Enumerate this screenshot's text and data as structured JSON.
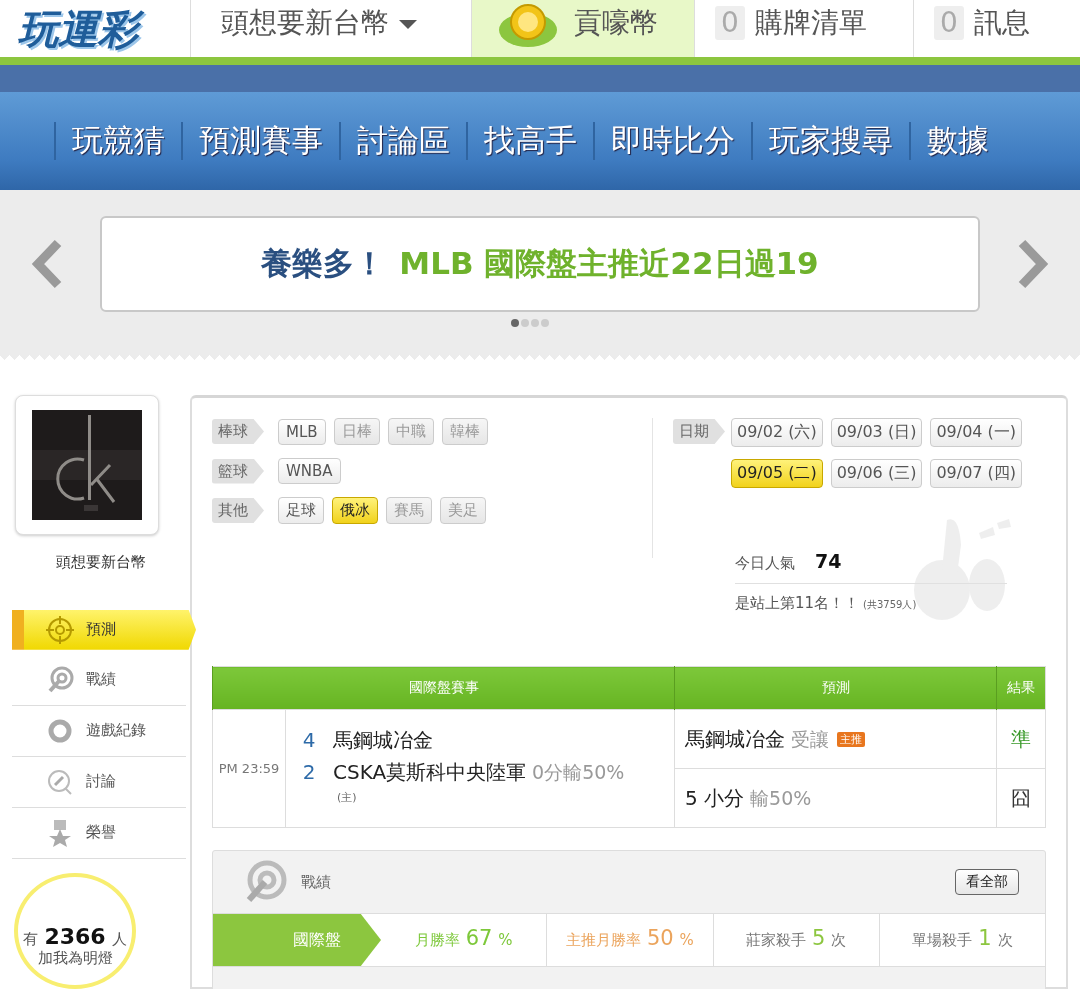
{
  "header": {
    "logo": "玩運彩",
    "user_menu": "頭想要新台幣",
    "coin_label": "貢嚎幣",
    "counters": [
      {
        "count": "0",
        "label": "購牌清單"
      },
      {
        "count": "0",
        "label": "訊息"
      }
    ]
  },
  "nav": [
    "玩競猜",
    "預測賽事",
    "討論區",
    "找高手",
    "即時比分",
    "玩家搜尋",
    "數據"
  ],
  "banner": {
    "lead": "養樂多！",
    "text": "MLB 國際盤主推近22日過19",
    "dots": [
      {
        "selected": true
      },
      {
        "selected": false
      },
      {
        "selected": false
      },
      {
        "selected": false
      }
    ]
  },
  "profile": {
    "name": "頭想要新台幣"
  },
  "side_menu": [
    {
      "label": "預測",
      "kind": "target",
      "selected": true
    },
    {
      "label": "戰績",
      "kind": "record",
      "selected": false
    },
    {
      "label": "遊戲紀錄",
      "kind": "ring",
      "selected": false
    },
    {
      "label": "討論",
      "kind": "chat",
      "selected": false
    },
    {
      "label": "榮譽",
      "kind": "medal",
      "selected": false
    }
  ],
  "fans": {
    "prefix": "有",
    "count": "2366",
    "suffix": "人",
    "caption": "加我為明燈"
  },
  "filters": {
    "sports": [
      {
        "category": "棒球",
        "chips": [
          {
            "label": "MLB",
            "selected": false,
            "disabled": false
          },
          {
            "label": "日棒",
            "selected": false,
            "disabled": true
          },
          {
            "label": "中職",
            "selected": false,
            "disabled": true
          },
          {
            "label": "韓棒",
            "selected": false,
            "disabled": true
          }
        ]
      },
      {
        "category": "籃球",
        "chips": [
          {
            "label": "WNBA",
            "selected": false,
            "disabled": false
          }
        ]
      },
      {
        "category": "其他",
        "chips": [
          {
            "label": "足球",
            "selected": false,
            "disabled": false
          },
          {
            "label": "俄冰",
            "selected": true,
            "disabled": false
          },
          {
            "label": "賽馬",
            "selected": false,
            "disabled": true
          },
          {
            "label": "美足",
            "selected": false,
            "disabled": true
          }
        ]
      }
    ],
    "date_label": "日期",
    "dates": [
      {
        "label": "09/02 (六)",
        "selected": false
      },
      {
        "label": "09/03 (日)",
        "selected": false
      },
      {
        "label": "09/04 (一)",
        "selected": false
      },
      {
        "label": "09/05 (二)",
        "selected": true
      },
      {
        "label": "09/06 (三)",
        "selected": false
      },
      {
        "label": "09/07 (四)",
        "selected": false
      }
    ]
  },
  "popularity": {
    "label": "今日人氣",
    "value": "74",
    "rank": "是站上第11名！！",
    "total": "(共3759人)"
  },
  "match_table": {
    "columns": [
      "國際盤賽事",
      "預測",
      "結果"
    ],
    "rows": [
      {
        "time": "PM 23:59",
        "teams": [
          {
            "score": "4",
            "name": "馬鋼城冶金"
          },
          {
            "score": "2",
            "name": "CSKA莫斯科中央陸軍",
            "line": "0分輸50%"
          }
        ],
        "home_note": "(主)",
        "predictions": [
          {
            "pick": "馬鋼城冶金",
            "detail": "受讓",
            "badge": "主推",
            "result": "準",
            "kind": "hit"
          },
          {
            "pick": "5 小分",
            "detail": "輸50%",
            "result": "囧",
            "kind": "miss"
          }
        ]
      }
    ]
  },
  "record": {
    "title": "戰績",
    "button": "看全部",
    "tab": "國際盤",
    "stats": [
      {
        "label": "月勝率",
        "value": "67",
        "unit": "%",
        "kind": "rate"
      },
      {
        "label": "主推月勝率",
        "value": "50",
        "unit": "%",
        "kind": "featured"
      },
      {
        "label": "莊家殺手",
        "value": "5",
        "unit": "次",
        "kind": "count"
      },
      {
        "label": "單場殺手",
        "value": "1",
        "unit": "次",
        "kind": "count"
      }
    ]
  }
}
